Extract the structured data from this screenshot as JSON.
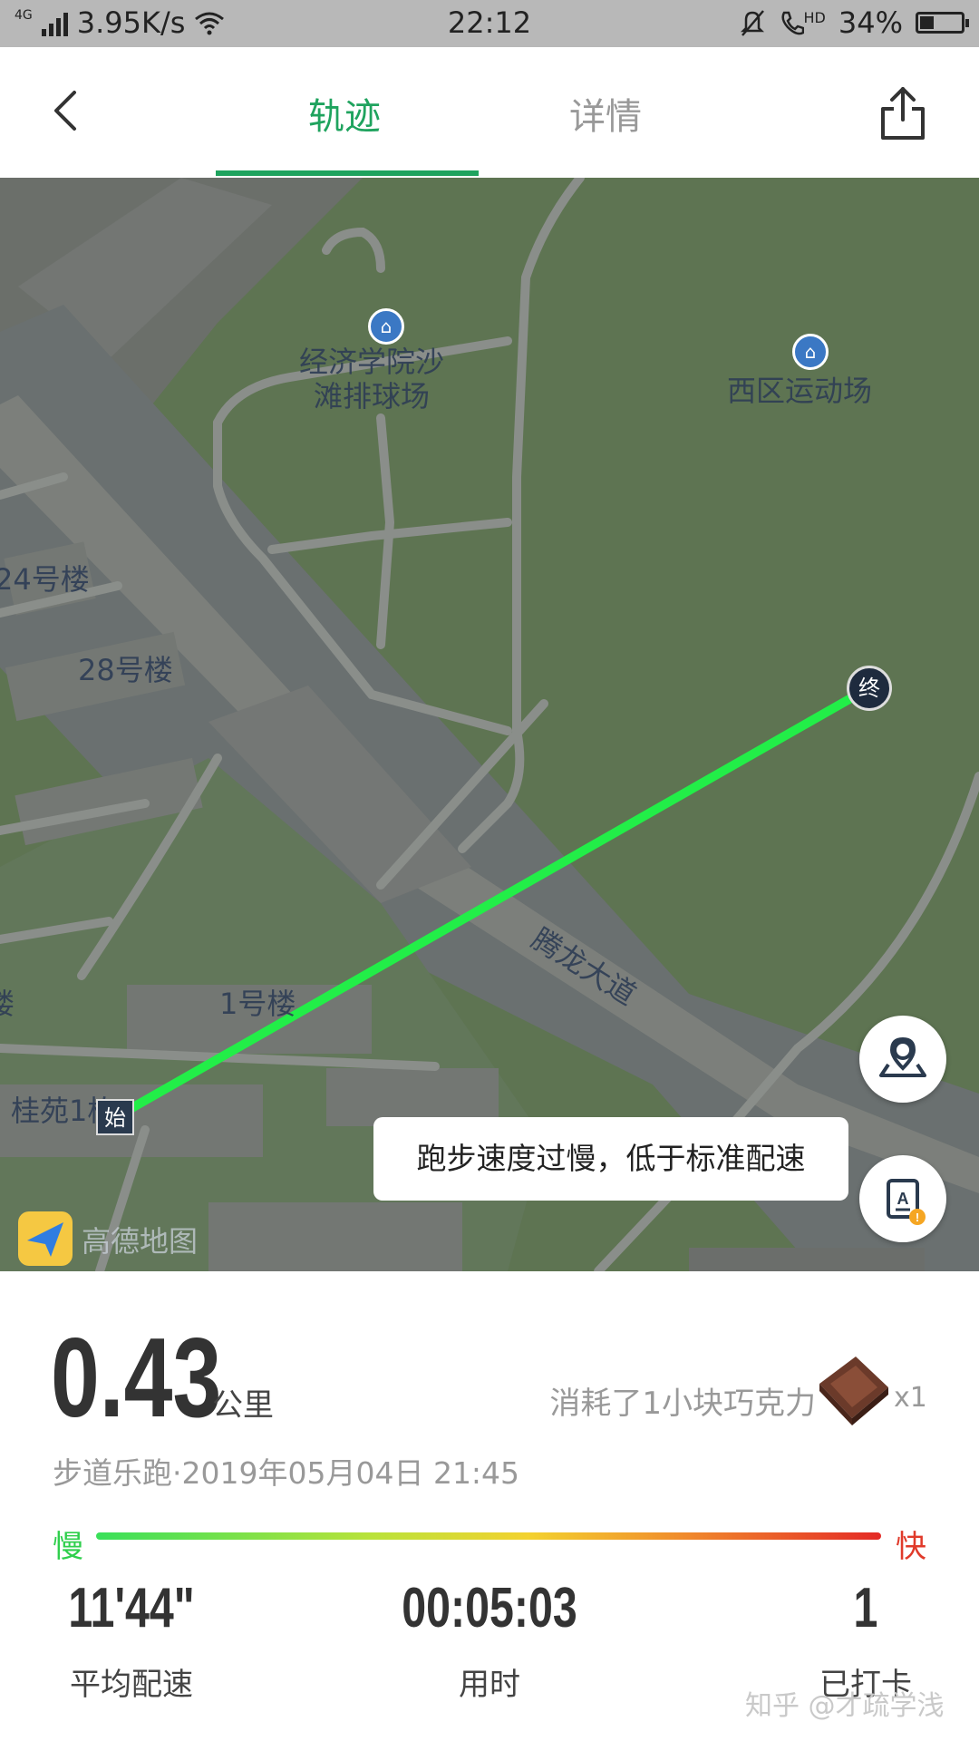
{
  "status_bar": {
    "network": "4G",
    "speed": "3.95K/s",
    "time": "22:12",
    "hd": "HD",
    "battery": "34%",
    "battery_level": 0.34
  },
  "header": {
    "tabs": [
      {
        "label": "轨迹",
        "active": true
      },
      {
        "label": "详情",
        "active": false
      }
    ],
    "accent_color": "#1fa35e"
  },
  "map": {
    "poi_labels": [
      "经济学院沙\n滩排球场",
      "西区运动场"
    ],
    "building_labels": [
      "24号楼",
      "28号楼",
      "1号楼",
      "桂苑1栋",
      "楼"
    ],
    "road_label": "腾龙大道",
    "start_marker": "始",
    "end_marker": "终",
    "toast": "跑步速度过慢，低于标准配速",
    "provider_logo_text": "高德地图",
    "track_color": "#22ee48"
  },
  "summary": {
    "distance": "0.43",
    "distance_unit": "公里",
    "calories_text": "消耗了1小块巧克力",
    "calories_multiplier": "x1",
    "meta": "步道乐跑·2019年05月04日 21:45",
    "slow_label": "慢",
    "fast_label": "快",
    "stats": [
      {
        "value": "11'44\"",
        "label": "平均配速"
      },
      {
        "value": "00:05:03",
        "label": "用时"
      },
      {
        "value": "1",
        "label": "已打卡"
      }
    ]
  },
  "watermark": "知乎 @才疏学浅"
}
